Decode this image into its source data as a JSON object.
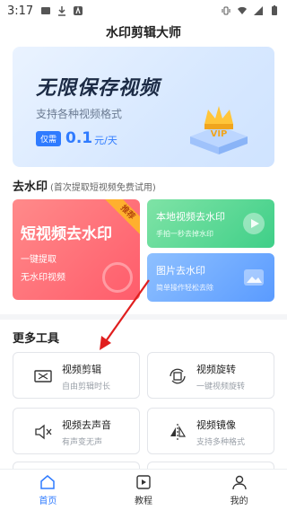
{
  "status_bar": {
    "time": "3:17"
  },
  "header": {
    "title": "水印剪辑大师"
  },
  "banner": {
    "headline": "无限保存视频",
    "subtitle": "支持各种视频格式",
    "tag": "仅需",
    "price": "0.1",
    "unit": "元/天",
    "vip_label": "VIP"
  },
  "watermark_section": {
    "heading": "去水印",
    "note": "(首次提取短视频免费试用)"
  },
  "cards": {
    "short_video": {
      "title": "短视频去水印",
      "ribbon": "推荐",
      "line1": "一键提取",
      "line2": "无水印视频"
    },
    "local_video": {
      "title": "本地视频去水印",
      "sub": "手拍一秒去掉水印"
    },
    "image": {
      "title": "图片去水印",
      "sub": "简单操作轻松去除"
    }
  },
  "more_tools": {
    "heading": "更多工具",
    "items": [
      {
        "name": "视频剪辑",
        "sub": "自由剪辑时长",
        "icon": "video-cut-icon"
      },
      {
        "name": "视频旋转",
        "sub": "一键视频旋转",
        "icon": "rotate-icon"
      },
      {
        "name": "视频去声音",
        "sub": "有声变无声",
        "icon": "mute-icon"
      },
      {
        "name": "视频镜像",
        "sub": "支持多种格式",
        "icon": "mirror-icon"
      }
    ]
  },
  "bottom_nav": {
    "items": [
      {
        "label": "首页",
        "icon": "home-icon",
        "active": true
      },
      {
        "label": "教程",
        "icon": "play-icon",
        "active": false
      },
      {
        "label": "我的",
        "icon": "user-icon",
        "active": false
      }
    ]
  },
  "colors": {
    "accent": "#2f7bff",
    "red_card": "#ff5c6b",
    "green_card": "#3fcf88",
    "blue_card": "#5a9bff",
    "arrow": "#e01e1e"
  }
}
